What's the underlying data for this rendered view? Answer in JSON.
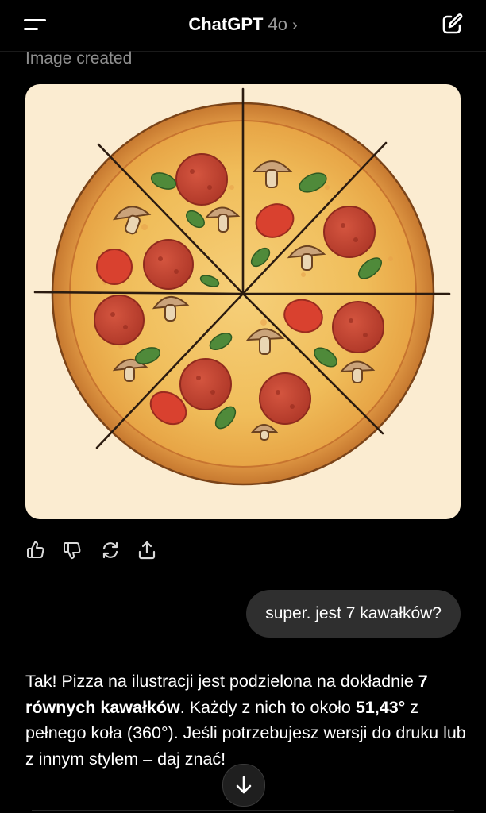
{
  "header": {
    "app_name": "ChatGPT",
    "model": "4o",
    "chevron": "›",
    "menu_icon": "menu-icon",
    "new_chat_icon": "new-chat-edit-icon"
  },
  "conversation": {
    "image_caption": "Image created",
    "image_subject": "pizza-with-pepperoni-mushrooms-tomatoes-basil-cut-into-slices",
    "action_icons": [
      "thumbs-up-icon",
      "thumbs-down-icon",
      "regenerate-icon",
      "share-icon"
    ],
    "user_message": "super. jest 7 kawałków?",
    "assistant_reply": {
      "p1": "Tak! Pizza na ilustracji jest podzielona na dokładnie ",
      "bold1": "7 równych kawałków",
      "p2": ". Każdy z nich to około ",
      "bold2": "51,43°",
      "p3": " z pełnego koła (360°). Jeśli potrzebujesz wersji do druku lub z innym stylem – daj znać!"
    }
  },
  "colors": {
    "background": "#000000",
    "bubble": "#2f2f2f",
    "muted_text": "#8e8e8e",
    "image_bg": "#fbecd1"
  }
}
